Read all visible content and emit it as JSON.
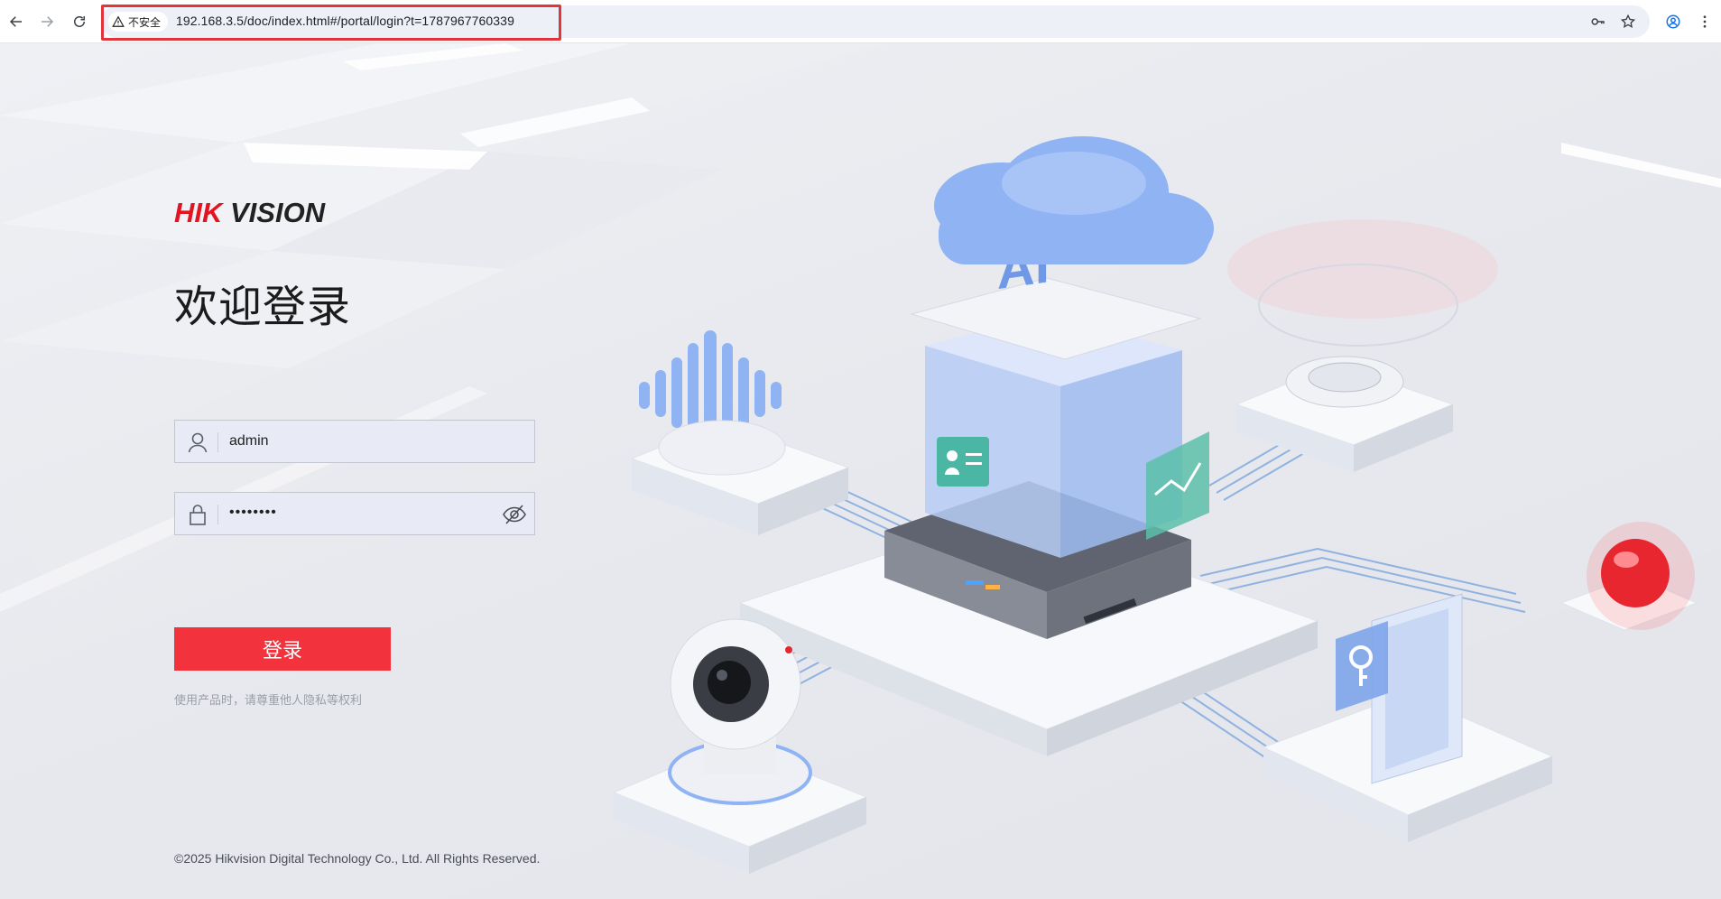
{
  "browser": {
    "security_label": "不安全",
    "url": "192.168.3.5/doc/index.html#/portal/login?t=1787967760339",
    "icons": {
      "back": "arrow-left-icon",
      "forward": "arrow-right-icon",
      "reload": "reload-icon",
      "warning": "warning-triangle-icon",
      "password_key": "key-icon",
      "bookmark": "star-icon",
      "profile": "profile-icon",
      "menu": "more-vertical-icon"
    }
  },
  "login": {
    "brand": "HIKVISION",
    "brand_colors": {
      "hik": "#e3141f",
      "vision": "#222222"
    },
    "title": "欢迎登录",
    "username": {
      "value": "admin",
      "icon": "user-icon"
    },
    "password": {
      "masked_value": "••••••••",
      "icon": "lock-icon",
      "toggle_icon": "eye-off-icon"
    },
    "submit_label": "登录",
    "privacy_notice": "使用产品时，请尊重他人隐私等权利",
    "accent_color": "#f2323c"
  },
  "footer": {
    "copyright": "©2025 Hikvision Digital Technology Co., Ltd. All Rights Reserved."
  }
}
